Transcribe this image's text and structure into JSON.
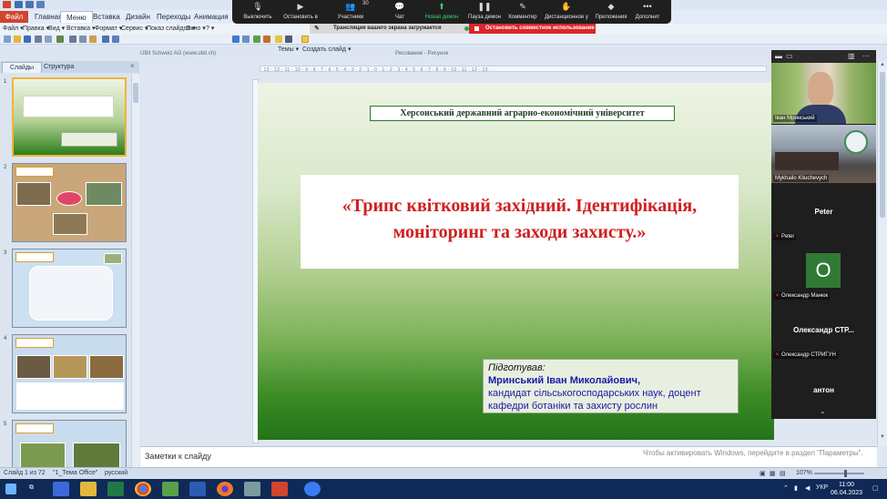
{
  "ribbon": {
    "tabs": [
      {
        "label": "Файл"
      },
      {
        "label": "Главная"
      },
      {
        "label": "Меню"
      },
      {
        "label": "Вставка"
      },
      {
        "label": "Дизайн"
      },
      {
        "label": "Переходы"
      },
      {
        "label": "Анимация"
      }
    ]
  },
  "menubar": {
    "items": [
      "Файл ▾",
      "Правка ▾",
      "Вид ▾",
      "Вставка ▾",
      "Формат ▾",
      "Сервис ▾",
      "Показ слайдов ▾",
      "Окно ▾",
      "? ▾"
    ]
  },
  "toolbar": {
    "ubix_label": "UBit Schweiz AG   (www.ubit.ch)",
    "draw_label": "Рисование - Рисунок",
    "themes_label": "Темы ▾",
    "layout_label": "Создать слайд ▾"
  },
  "zoom_bar": {
    "buttons": [
      {
        "label": "Выключить",
        "icon": "🎙"
      },
      {
        "label": "Остановить в",
        "icon": "▶"
      },
      {
        "label": "Участники",
        "icon": "👥"
      },
      {
        "label": "Чат",
        "icon": "💬"
      },
      {
        "label": "Новая демон",
        "icon": "⬆"
      },
      {
        "label": "Пауза демон",
        "icon": "❚❚"
      },
      {
        "label": "Комментир",
        "icon": "✎"
      },
      {
        "label": "Дистанционное у",
        "icon": "✋"
      },
      {
        "label": "Приложения",
        "icon": "◆"
      },
      {
        "label": "Дополнит",
        "icon": "•••"
      }
    ],
    "participant_count": "30",
    "share_status": "Трансляция вашего экрана загружается",
    "stop_share": "Остановить совместное использование"
  },
  "slides_panel": {
    "tab_slides": "Слайды",
    "tab_outline": "Структура",
    "close_glyph": "×",
    "thumbnails": [
      {
        "num": "1"
      },
      {
        "num": "2"
      },
      {
        "num": "3"
      },
      {
        "num": "4"
      },
      {
        "num": "5"
      }
    ]
  },
  "slide": {
    "university": "Херсонський державний аграрно-економічний університет",
    "title_line1": "«Трипс квітковий західний. Ідентифікація,",
    "title_line2": "моніторинг та заходи захисту.»",
    "prepared_by": "Підготував:",
    "author_name": "Мринський Іван Миколайович,",
    "author_line2": "кандидат сільськогосподарських наук, доцент",
    "author_line3": "кафедри ботаніки та захисту рослин"
  },
  "notes": {
    "label": "Заметки к слайду",
    "activate_windows": "Чтобы активировать Windows, перейдите в раздел \"Параметры\"."
  },
  "status": {
    "slide_of": "Слайд 1 из 72",
    "theme": "\"1_Тема Office\"",
    "language": "русский",
    "zoom": "107%",
    "zoom_value": 107
  },
  "participants": {
    "tiles": [
      {
        "name": "Іван Мринський"
      },
      {
        "name": "Mykhailo    Kliuchevych"
      },
      {
        "name": "Peter",
        "center": "Peter"
      },
      {
        "name": "Олександр Манюк",
        "initial": "О"
      },
      {
        "name": "Олександр СТРИГУН",
        "center": "Олександр  СТР..."
      },
      {
        "name": "",
        "center": "антон"
      }
    ]
  },
  "taskbar": {
    "time": "11:00",
    "date": "06.04.2023",
    "lang": "УКР"
  },
  "colors": {
    "slide_title": "#cf1f1f",
    "author_text": "#1a1aa6",
    "stop_share": "#d9262b",
    "zoom_green": "#35d366"
  }
}
